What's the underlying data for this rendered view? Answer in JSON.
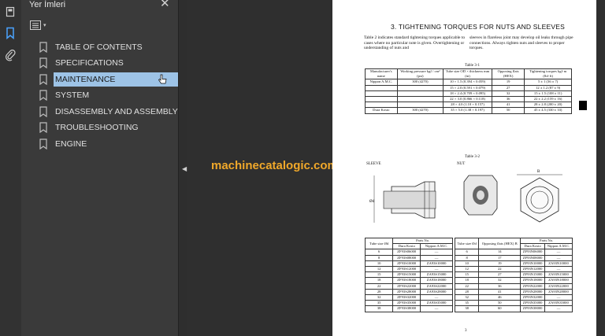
{
  "sidebar": {
    "title": "Yer İmleri",
    "close_icon": "close-icon",
    "tools": [
      "page-thumbnails-icon",
      "bookmark-icon",
      "attachment-icon"
    ],
    "items": [
      {
        "label": "TABLE OF CONTENTS",
        "selected": false
      },
      {
        "label": "SPECIFICATIONS",
        "selected": false
      },
      {
        "label": "MAINTENANCE",
        "selected": true
      },
      {
        "label": "SYSTEM",
        "selected": false
      },
      {
        "label": "DISASSEMBLY AND ASSEMBLY",
        "selected": false
      },
      {
        "label": "TROUBLESHOOTING",
        "selected": false
      },
      {
        "label": "ENGINE",
        "selected": false
      }
    ]
  },
  "watermark": "machinecatalogic.com",
  "document": {
    "section_title": "3.  TIGHTENING TORQUES FOR NUTS AND SLEEVES",
    "intro_left": "Table 2 indicates standard tightening torques applicable to cases where no particular note is given. Overtightening or understanding of nuts and",
    "intro_right": "sleeves in flareless joint may develop oil leaks through pipe connections. Always tighten nuts and sleeves to proper torques.",
    "table1_caption": "Table 3-1",
    "table1_headers": [
      "Manufacturer's name",
      "Working pressure kgf / cm² (psi)",
      "Tube size OD × thickness mm (in)",
      "Opposing flats (HEX)",
      "Tightening torques kgf·m (lbf·ft)"
    ],
    "table1_rows": [
      [
        "Nippon A.M.C.",
        "300 (4270)",
        "10 × 1.5 (0.394 × 0.059)",
        "19",
        "5 ± 1 (36 ± 7)"
      ],
      [
        "",
        "",
        "15 × 2.0 (0.591 × 0.079)",
        "27",
        "12 ± 1.2 (87 ± 9)"
      ],
      [
        "",
        "",
        "18 × 2.4 (0.709 × 0.095)",
        "32",
        "15 ± 1.5 (108 ± 11)"
      ],
      [
        "",
        "",
        "22 × 3.0 (0.866 × 0.118)",
        "36",
        "22 ± 2.2 (159 ± 16)"
      ],
      [
        "",
        "",
        "28 × 4.0 (1.10 × 0.157)",
        "41",
        "28 ± 2.8 (200 ± 20)"
      ],
      [
        "Dura Kosto",
        "300 (4270)",
        "35 × 5.0 (1.38 × 0.197)",
        "50",
        "45 ± 4.5 (330 ± 33)"
      ]
    ],
    "table2_caption": "Table 3-2",
    "sleeve_label": "SLEEVE",
    "nut_label": "NUT",
    "dim_od": "Ød",
    "dim_b": "B",
    "sleeve_headers": [
      "Tube size Ød",
      "Dura Kosto",
      "Nippon A.M.C."
    ],
    "sleeve_group_header": "Parts No.",
    "sleeve_rows": [
      [
        "6",
        "ZF93S06000",
        "—"
      ],
      [
        "8",
        "ZF93S08000",
        "—"
      ],
      [
        "10",
        "ZF93S10000",
        "ZA93S10000"
      ],
      [
        "12",
        "ZF93S12000",
        "—"
      ],
      [
        "15",
        "ZF93S15000",
        "ZA93S15000"
      ],
      [
        "18",
        "ZF93S18000",
        "ZA93S18000"
      ],
      [
        "22",
        "ZF93S22000",
        "ZA93S22000"
      ],
      [
        "28",
        "ZF93S28000",
        "ZA93S28000"
      ],
      [
        "32",
        "ZF93S32000",
        "—"
      ],
      [
        "35",
        "ZF93S35000",
        "ZA93S35000"
      ],
      [
        "38",
        "ZF93S38000",
        "—"
      ]
    ],
    "nut_headers": [
      "Tube size Ød",
      "Opposing flats (HEX) B",
      "Dura Kosto",
      "Nippon A.M.C."
    ],
    "nut_group_header": "Parts No.",
    "nut_rows": [
      [
        "6",
        "14",
        "ZF93N06000",
        "—"
      ],
      [
        "8",
        "17",
        "ZF93N08000",
        "—"
      ],
      [
        "10",
        "19",
        "ZF93N10000",
        "ZA93N10000"
      ],
      [
        "12",
        "22",
        "ZF93N12000",
        "—"
      ],
      [
        "15",
        "27",
        "ZF93N15000",
        "ZA93N15000"
      ],
      [
        "18",
        "32",
        "ZF93N18000",
        "ZA93N18000"
      ],
      [
        "22",
        "36",
        "ZF93N22000",
        "ZA93N22000"
      ],
      [
        "28",
        "41",
        "ZF93N28000",
        "ZA93N28000"
      ],
      [
        "32",
        "46",
        "ZF93N32000",
        "—"
      ],
      [
        "35",
        "50",
        "ZF93N35000",
        "ZA93N35000"
      ],
      [
        "38",
        "60",
        "ZF93N38000",
        "—"
      ]
    ],
    "page_number": "3"
  },
  "colors": {
    "panel_bg": "#3a3a3a",
    "selected_bg": "#9dc3e6",
    "watermark": "#f0a82a"
  }
}
